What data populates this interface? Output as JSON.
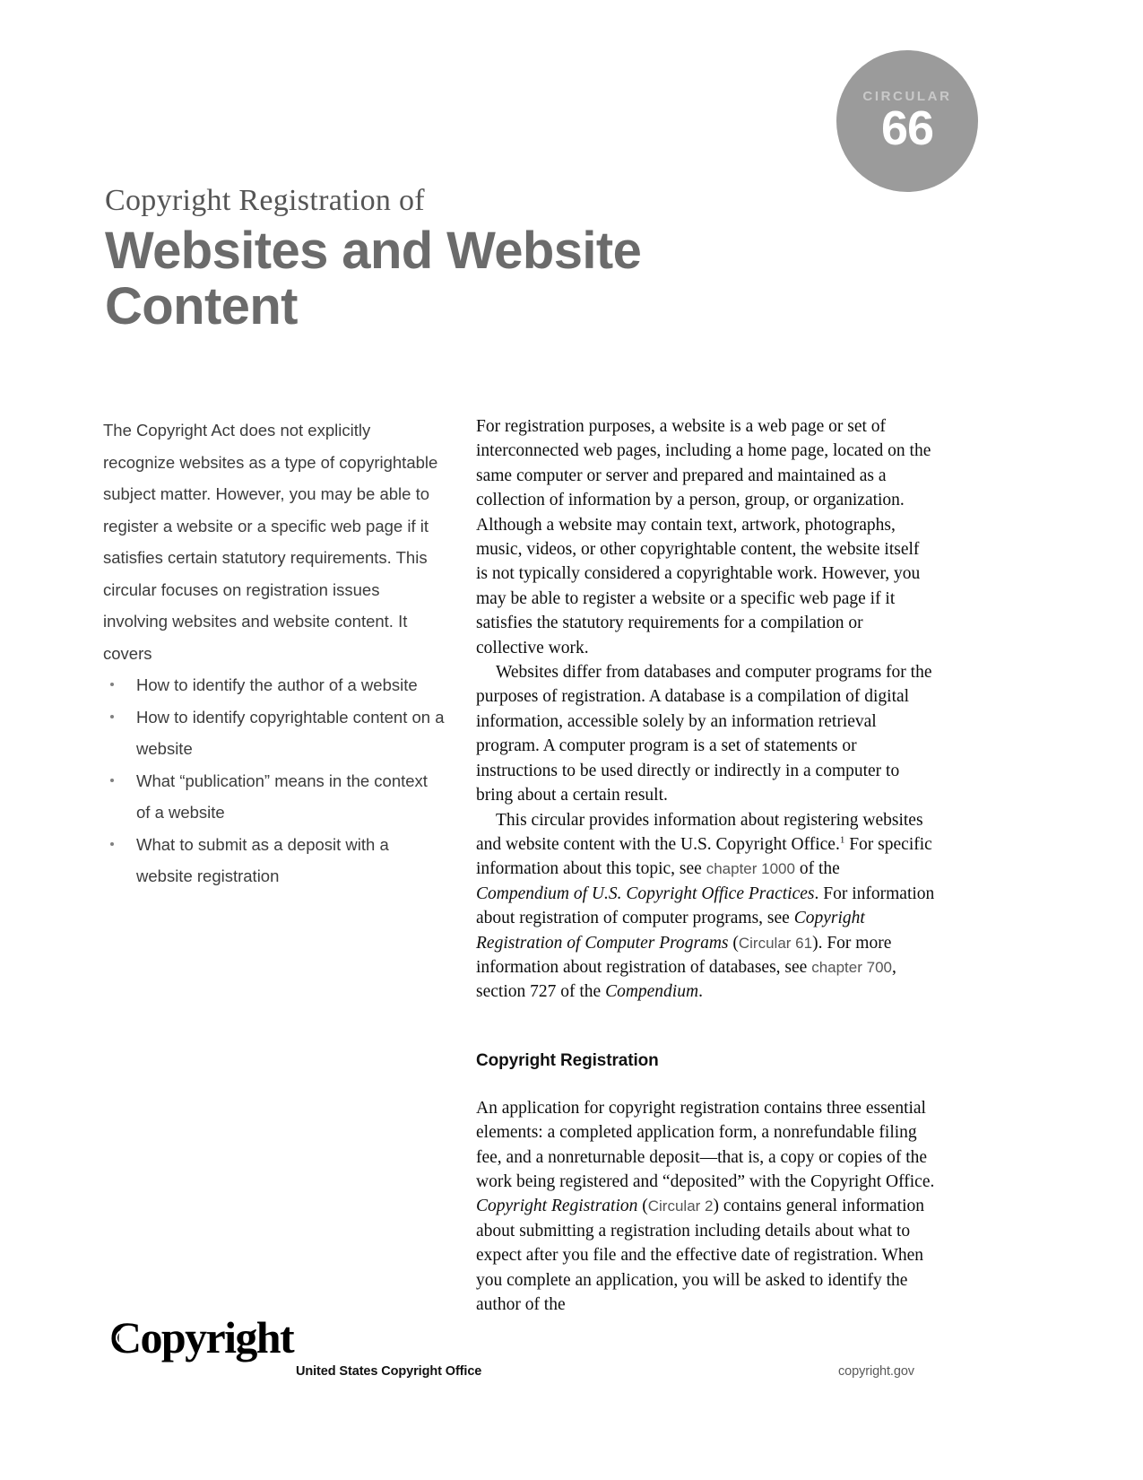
{
  "badge": {
    "label": "CIRCULAR",
    "number": "66",
    "color": "#9b9b9b"
  },
  "title": {
    "kicker": "Copyright Registration of",
    "main_line1": "Websites and Website",
    "main_line2": "Content",
    "color": "#6b6b6b"
  },
  "left_column": {
    "intro": "The Copyright Act does not explicitly recognize websites as a type of copyrightable subject matter. However, you may be able to register a website or a specific web page if it satisfies certain statutory requirements. This circular focuses on registration issues involving websites and website content. It covers",
    "bullets": [
      "How to identify the author of a website",
      "How to identify copyrightable content on a website",
      "What “publication” means in the context of a website",
      "What to submit as a deposit with a website registration"
    ]
  },
  "right_column": {
    "paragraph_1": "For registration purposes, a website is a web page or set of interconnected web pages, including a home page, located on the same computer or server and prepared and maintained as a collection of information by a person, group, or organization. Although a website may contain text, artwork, photographs, music, videos, or other copyrightable content, the website itself is not typically considered a copyrightable work. However, you may be able to register a website or a specific web page if it satisfies the statutory requirements for a compilation or collective work.",
    "paragraph_2": "Websites differ from databases and computer programs for the purposes of registration. A database is a compilation of digital information, accessible solely by an information retrieval program. A computer program is a set of statements or instructions to be used directly or indirectly in a computer to bring about a certain result.",
    "paragraph_3": {
      "part_1": "This circular provides information about registering websites and website content with the U.S. Copyright Office.",
      "footnote_marker": "1",
      "part_2": " For specific information about this topic, see ",
      "link_1": "chapter 1000",
      "part_3": " of the ",
      "italic_1": "Compendium of U.S. Copyright Office Practices",
      "part_4": ". For information about registration of computer programs, see ",
      "italic_2": "Copyright Registration of Computer Programs",
      "part_5": " (",
      "link_2": "Circular 61",
      "part_6": "). For more information about registration of databases, see ",
      "link_3": "chapter 700",
      "part_7": ", section 727 of the ",
      "italic_3": "Compendium",
      "part_8": "."
    },
    "section_heading": "Copyright Registration",
    "paragraph_4": {
      "part_1": "An application for copyright registration contains three essential elements: a completed application form, a nonrefundable filing fee, and a nonreturnable deposit—that is, a copy or copies of the work being registered and “deposited” with the Copyright Office. ",
      "italic_1": "Copyright Registration",
      "part_2": " (",
      "link_1": "Circular 2",
      "part_3": ") contains general information about submitting a registration including details about what to expect after you file and the effective date of registration. When you complete an application, you will be asked to identify the author of the"
    }
  },
  "footer": {
    "logo_c": "C",
    "logo_rest": "opyright",
    "office": "United States Copyright Office",
    "url": "copyright.gov"
  }
}
